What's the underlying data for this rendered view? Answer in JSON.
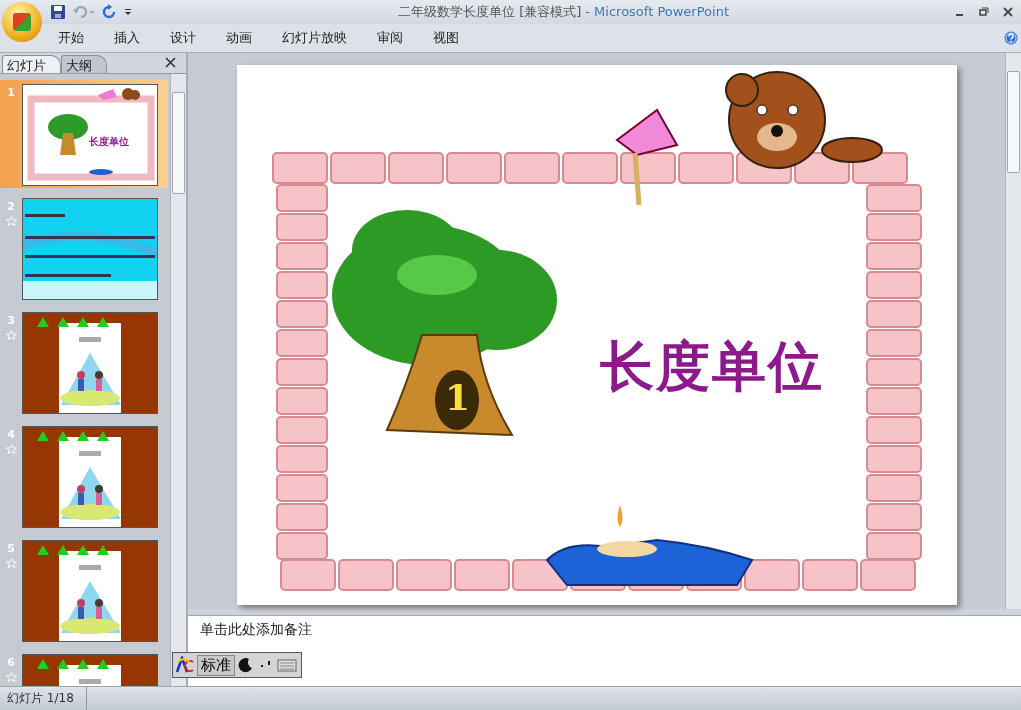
{
  "window": {
    "document_title": "二年级数学长度单位 [兼容模式]",
    "app_title": "- Microsoft PowerPoint"
  },
  "ribbon_tabs": [
    {
      "label": "开始",
      "selected": false
    },
    {
      "label": "插入",
      "selected": false
    },
    {
      "label": "设计",
      "selected": false
    },
    {
      "label": "动画",
      "selected": false
    },
    {
      "label": "幻灯片放映",
      "selected": false
    },
    {
      "label": "审阅",
      "selected": false
    },
    {
      "label": "视图",
      "selected": false
    }
  ],
  "panel_tabs": [
    {
      "label": "幻灯片",
      "selected": true
    },
    {
      "label": "大纲",
      "selected": false
    }
  ],
  "slides": [
    {
      "number": "1",
      "selected": true,
      "animated": false,
      "kind": "title",
      "caption": "长度单位"
    },
    {
      "number": "2",
      "selected": false,
      "animated": true,
      "kind": "list"
    },
    {
      "number": "3",
      "selected": false,
      "animated": true,
      "kind": "cover"
    },
    {
      "number": "4",
      "selected": false,
      "animated": true,
      "kind": "cover"
    },
    {
      "number": "5",
      "selected": false,
      "animated": true,
      "kind": "cover"
    },
    {
      "number": "6",
      "selected": false,
      "animated": true,
      "kind": "cover"
    }
  ],
  "slide": {
    "title": "长度单位",
    "tree_number": "1"
  },
  "notes": {
    "placeholder": "单击此处添加备注"
  },
  "ime_toolbar": {
    "mode": "标准"
  },
  "status_bar": {
    "slide_counter": "幻灯片 1/18"
  }
}
